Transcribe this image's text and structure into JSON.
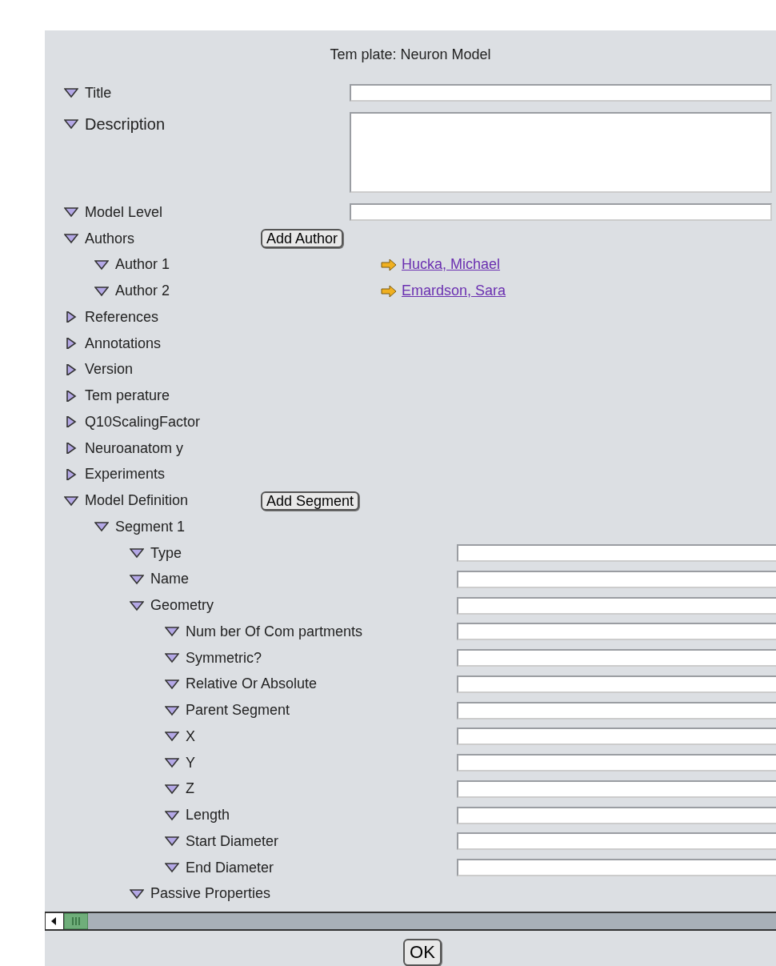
{
  "header": {
    "title": "Tem plate: Neuron Model"
  },
  "tree": [
    {
      "label": "Title",
      "expanded": true,
      "kind": "field"
    },
    {
      "label": "Description",
      "expanded": true,
      "kind": "area"
    },
    {
      "label": "Model Level",
      "expanded": true,
      "kind": "field"
    },
    {
      "label": "Authors",
      "expanded": true,
      "kind": "button",
      "button": "Add Author",
      "children": [
        {
          "label": "Author 1",
          "expanded": true,
          "kind": "link",
          "link": "Hucka, Michael"
        },
        {
          "label": "Author 2",
          "expanded": true,
          "kind": "link",
          "link": "Emardson, Sara"
        }
      ]
    },
    {
      "label": "References",
      "expanded": false,
      "kind": "plain"
    },
    {
      "label": "Annotations",
      "expanded": false,
      "kind": "plain"
    },
    {
      "label": "Version",
      "expanded": false,
      "kind": "plain"
    },
    {
      "label": "Tem perature",
      "expanded": false,
      "kind": "plain"
    },
    {
      "label": "Q10ScalingFactor",
      "expanded": false,
      "kind": "plain"
    },
    {
      "label": "Neuroanatom y",
      "expanded": false,
      "kind": "plain"
    },
    {
      "label": "Experiments",
      "expanded": false,
      "kind": "plain"
    },
    {
      "label": "Model Definition",
      "expanded": true,
      "kind": "button",
      "button": "Add Segment",
      "children": [
        {
          "label": "Segment 1",
          "expanded": true,
          "kind": "plain",
          "children": [
            {
              "label": "Type",
              "expanded": true,
              "kind": "field"
            },
            {
              "label": "Name",
              "expanded": true,
              "kind": "field"
            },
            {
              "label": "Geometry",
              "expanded": true,
              "kind": "field",
              "children": [
                {
                  "label": "Num ber Of Com partments",
                  "expanded": true,
                  "kind": "field"
                },
                {
                  "label": "Symmetric?",
                  "expanded": true,
                  "kind": "field"
                },
                {
                  "label": "Relative Or Absolute",
                  "expanded": true,
                  "kind": "field"
                },
                {
                  "label": "Parent Segment",
                  "expanded": true,
                  "kind": "field"
                },
                {
                  "label": "X",
                  "expanded": true,
                  "kind": "field"
                },
                {
                  "label": "Y",
                  "expanded": true,
                  "kind": "field"
                },
                {
                  "label": "Z",
                  "expanded": true,
                  "kind": "field"
                },
                {
                  "label": "Length",
                  "expanded": true,
                  "kind": "field"
                },
                {
                  "label": "Start Diameter",
                  "expanded": true,
                  "kind": "field"
                },
                {
                  "label": "End Diameter",
                  "expanded": true,
                  "kind": "field"
                }
              ]
            },
            {
              "label": "Passive Properties",
              "expanded": true,
              "kind": "plain"
            }
          ]
        }
      ]
    }
  ],
  "ok_button": "OK"
}
